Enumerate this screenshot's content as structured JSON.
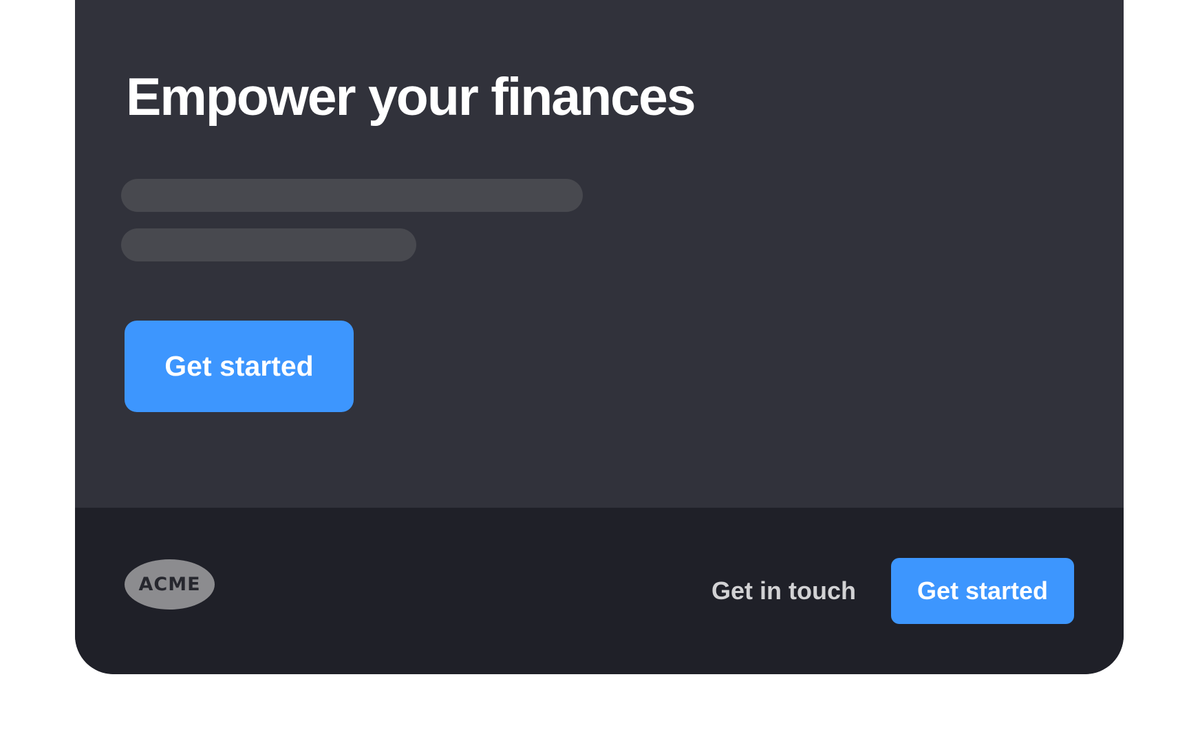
{
  "hero": {
    "title": "Empower your finances",
    "cta_label": "Get started",
    "description_lines": [
      "",
      ""
    ]
  },
  "footer": {
    "logo_text": "ACME",
    "contact_label": "Get in touch",
    "cta_label": "Get started"
  },
  "colors": {
    "hero_background": "#31323b",
    "footer_background": "#1f2028",
    "accent": "#3d96fe",
    "skeleton": "#48494f",
    "logo_badge": "#8c8c8f"
  }
}
